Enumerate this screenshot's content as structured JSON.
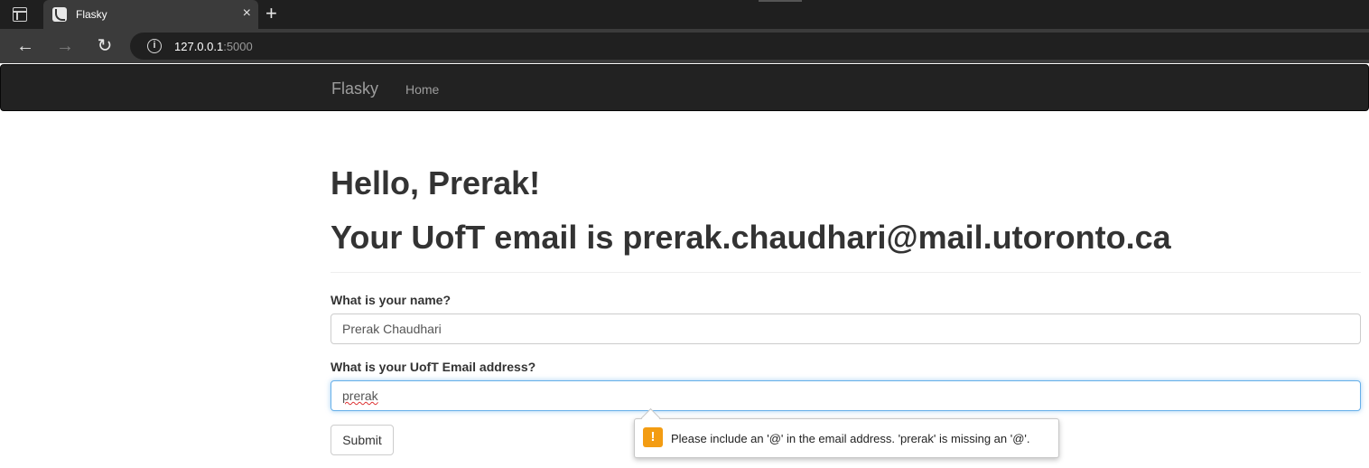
{
  "browser": {
    "tab_title": "Flasky",
    "tab_close": "×",
    "new_tab": "+",
    "url_host": "127.0.0.1",
    "url_port": ":5000",
    "back": "←",
    "forward": "→",
    "reload": "↻",
    "info": "i"
  },
  "navbar": {
    "brand": "Flasky",
    "links": [
      "Home"
    ]
  },
  "page": {
    "greeting": "Hello, Prerak!",
    "email_line": "Your UofT email is prerak.chaudhari@mail.utoronto.ca"
  },
  "form": {
    "name_label": "What is your name?",
    "name_value": "Prerak Chaudhari",
    "email_label": "What is your UofT Email address?",
    "email_value": "prerak",
    "submit_label": "Submit"
  },
  "validation": {
    "icon": "!",
    "message": "Please include an '@' in the email address. 'prerak' is missing an '@'."
  },
  "colors": {
    "navbar_bg": "#222222",
    "focus_border": "#66afe9",
    "warning": "#f39c12"
  }
}
